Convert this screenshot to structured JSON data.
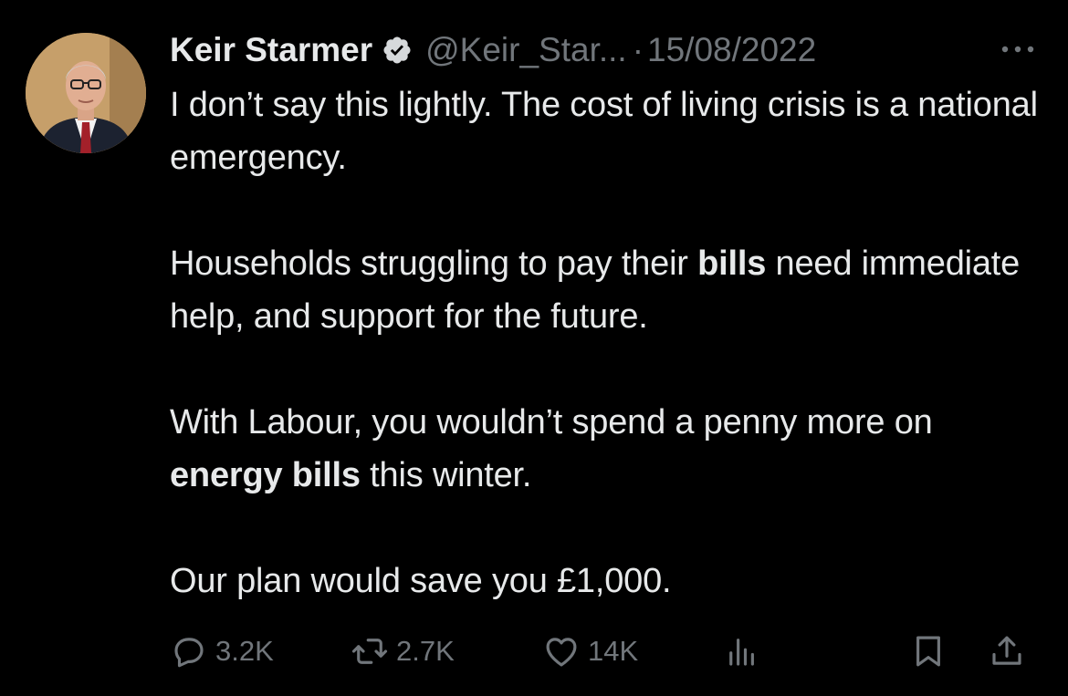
{
  "tweet": {
    "author_name": "Keir Starmer",
    "handle": "@Keir_Star...",
    "separator": "·",
    "date": "15/08/2022",
    "paragraphs": [
      [
        {
          "text": "I don’t say this lightly. The cost of living crisis is a national emergency.",
          "bold": false
        }
      ],
      [
        {
          "text": "Households struggling to pay their ",
          "bold": false
        },
        {
          "text": "bills",
          "bold": true
        },
        {
          "text": " need immediate help, and support for the future.",
          "bold": false
        }
      ],
      [
        {
          "text": "With Labour, you wouldn’t spend a penny more on ",
          "bold": false
        },
        {
          "text": "energy bills",
          "bold": true
        },
        {
          "text": " this winter.",
          "bold": false
        }
      ],
      [
        {
          "text": "Our plan would save you £1,000.",
          "bold": false
        }
      ]
    ]
  },
  "actions": {
    "replies": "3.2K",
    "reposts": "2.7K",
    "likes": "14K"
  },
  "icons": {
    "verified": "verified-badge-icon",
    "more": "more-dots-icon",
    "reply": "reply-bubble-icon",
    "repost": "repost-arrows-icon",
    "like": "heart-icon",
    "views": "bar-chart-icon",
    "bookmark": "bookmark-icon",
    "share": "share-upload-icon"
  },
  "colors": {
    "background": "#000000",
    "text": "#e7e9ea",
    "secondary": "#71767b",
    "verified_badge": "#d6d9db"
  }
}
